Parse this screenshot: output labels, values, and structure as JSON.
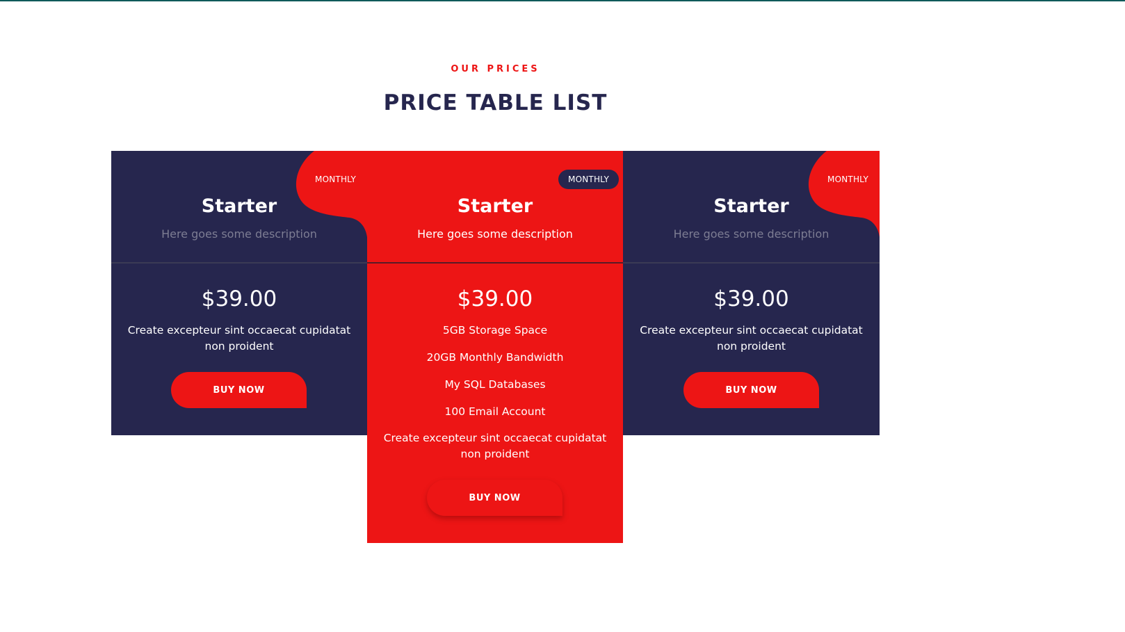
{
  "header": {
    "eyebrow": "OUR PRICES",
    "title": "PRICE TABLE LIST"
  },
  "colors": {
    "navy": "#26264e",
    "red": "#ed1515",
    "white": "#ffffff"
  },
  "plans": [
    {
      "badge": "MONTHLY",
      "name": "Starter",
      "description": "Here goes some description",
      "price": "$39.00",
      "text": "Create excepteur sint occaecat cupidatat non proident",
      "button": "BUY NOW"
    },
    {
      "badge": "MONTHLY",
      "name": "Starter",
      "description": "Here goes some description",
      "price": "$39.00",
      "features": [
        "5GB Storage Space",
        "20GB Monthly Bandwidth",
        "My SQL Databases",
        "100 Email Account"
      ],
      "text": "Create excepteur sint occaecat cupidatat non proident",
      "button": "BUY NOW"
    },
    {
      "badge": "MONTHLY",
      "name": "Starter",
      "description": "Here goes some description",
      "price": "$39.00",
      "text": "Create excepteur sint occaecat cupidatat non proident",
      "button": "BUY NOW"
    }
  ]
}
